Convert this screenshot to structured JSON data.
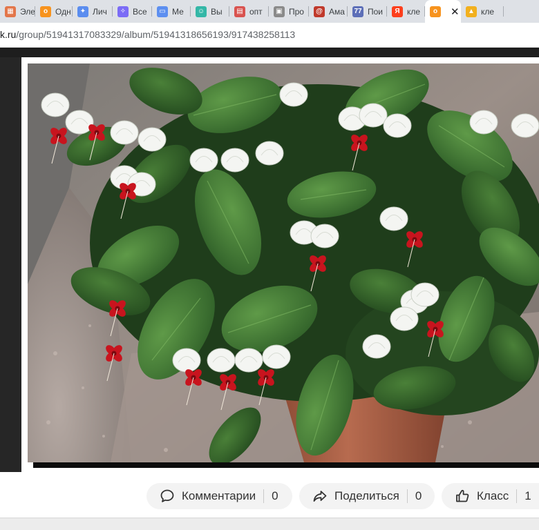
{
  "browser": {
    "tabs": [
      {
        "label": "Эле",
        "icon": "building-icon",
        "color": "#e3764a",
        "glyph": "▦"
      },
      {
        "label": "Одн",
        "icon": "ok-icon",
        "color": "#f7931e",
        "glyph": "о"
      },
      {
        "label": "Лич",
        "icon": "apps-icon",
        "color": "#5b8def",
        "glyph": "✦"
      },
      {
        "label": "Все",
        "icon": "sparkle-icon",
        "color": "#7b6cf6",
        "glyph": "✧"
      },
      {
        "label": "Ме",
        "icon": "chat-icon",
        "color": "#5d8ff0",
        "glyph": "▭"
      },
      {
        "label": "Вы",
        "icon": "smile-icon",
        "color": "#34b7a7",
        "glyph": "☺"
      },
      {
        "label": "опт",
        "icon": "document-icon",
        "color": "#d9534f",
        "glyph": "▤"
      },
      {
        "label": "Про",
        "icon": "monitor-icon",
        "color": "#8a8a8a",
        "glyph": "▣"
      },
      {
        "label": "Ама",
        "icon": "spiral-icon",
        "color": "#c0392b",
        "glyph": "@"
      },
      {
        "label": "Пои",
        "icon": "number-icon",
        "color": "#5d6fb8",
        "glyph": "77"
      },
      {
        "label": "кле",
        "icon": "yandex-icon",
        "color": "#fc3f1d",
        "glyph": "Я"
      },
      {
        "label": "",
        "icon": "ok-icon",
        "color": "#f7931e",
        "glyph": "о",
        "active": true,
        "close": "✕"
      },
      {
        "label": "кле",
        "icon": "image-icon",
        "color": "#f2b01e",
        "glyph": "▲"
      }
    ],
    "url_host": "k.ru",
    "url_path": "/group/51941317083329/album/51941318656193/917438258113"
  },
  "actions": {
    "comments_label": "Комментарии",
    "comments_count": "0",
    "share_label": "Поделиться",
    "share_count": "0",
    "like_label": "Класс",
    "like_count": "1"
  }
}
